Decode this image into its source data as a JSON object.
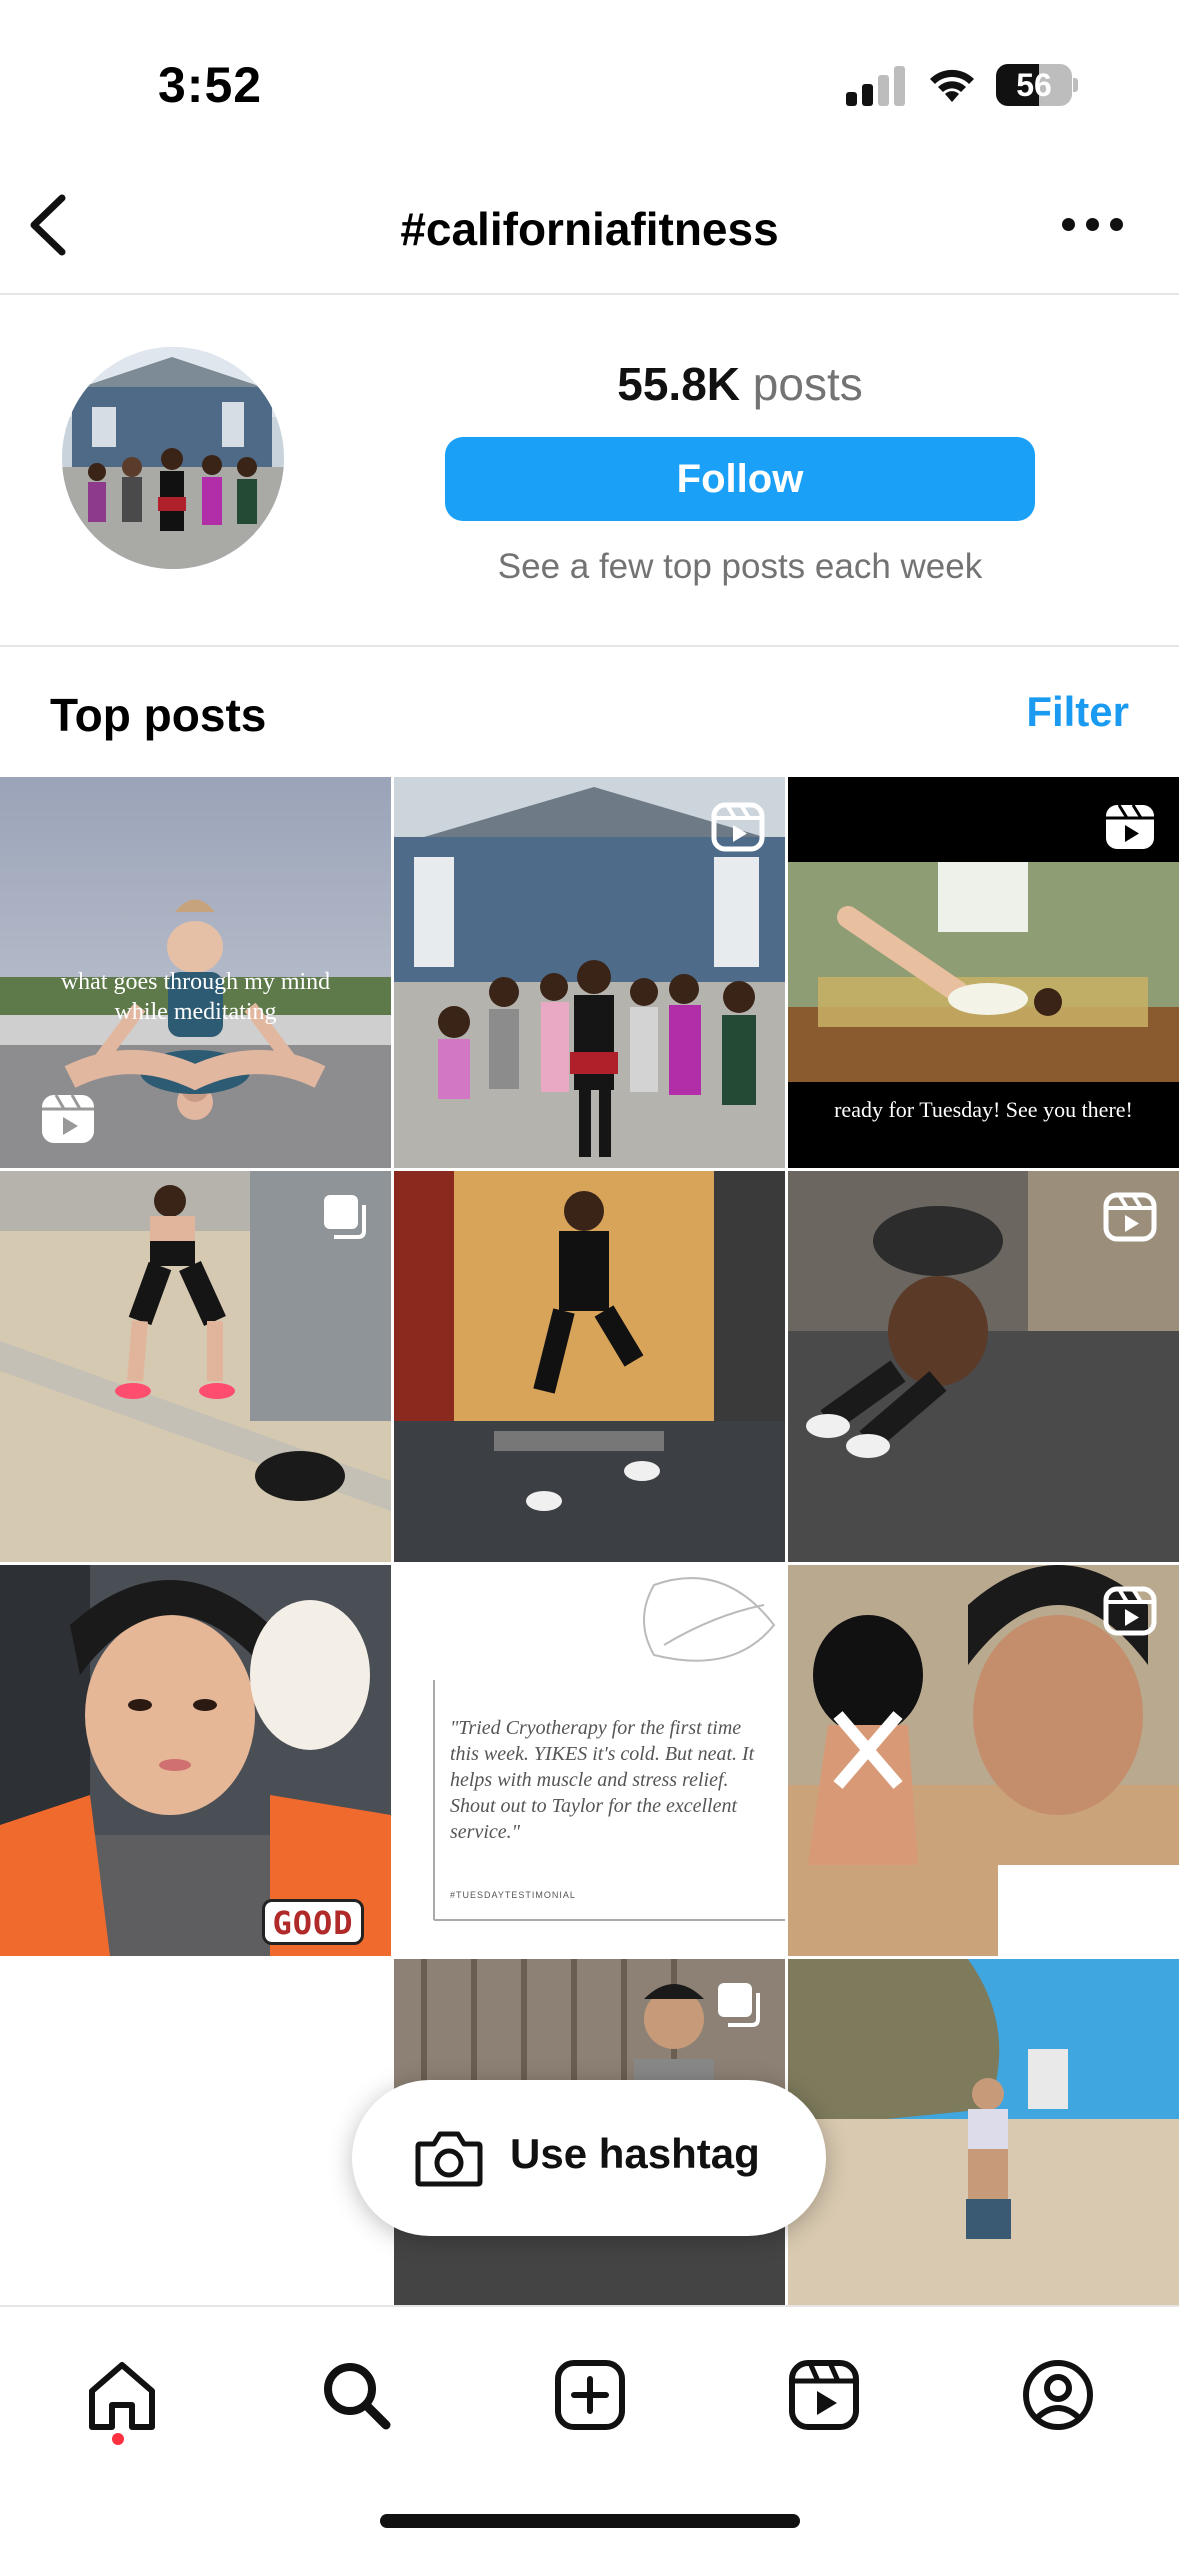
{
  "status_bar": {
    "time": "3:52",
    "battery_level": "56",
    "icons": [
      "cellular-signal-icon",
      "wifi-icon",
      "battery-icon"
    ]
  },
  "header": {
    "title": "#californiafitness",
    "icons": [
      "back-chevron-icon",
      "more-options-icon"
    ]
  },
  "profile": {
    "posts_count": "55.8K",
    "posts_label": "posts",
    "follow_label": "Follow",
    "follow_note": "See a few top posts each week"
  },
  "top_posts": {
    "title": "Top posts",
    "filter_label": "Filter",
    "tiles": [
      {
        "overlay_text": "what goes through my mind while meditating",
        "badge": "reels-icon"
      },
      {
        "overlay_text": "",
        "badge": "reels-icon"
      },
      {
        "overlay_text": "ready for Tuesday! See you there!",
        "badge": "reels-icon"
      },
      {
        "overlay_text": "",
        "badge": "carousel-icon"
      },
      {
        "overlay_text": "",
        "badge": ""
      },
      {
        "overlay_text": "",
        "badge": "reels-icon"
      },
      {
        "overlay_text": "GOOD",
        "badge": ""
      },
      {
        "overlay_text": "\"Tried Cryotherapy for the first time this week. YIKES it's cold. But neat. It helps with muscle and stress relief. Shout out to Taylor for the excellent service.\"",
        "caption_tag": "#TUESDAYTESTIMONIAL",
        "badge": ""
      },
      {
        "overlay_text": "",
        "badge": "reels-icon"
      },
      {
        "overlay_text": "",
        "badge": "carousel-icon"
      },
      {
        "overlay_text": "",
        "badge": ""
      }
    ]
  },
  "floating_button": {
    "label": "Use hashtag",
    "icon": "camera-icon"
  },
  "bottom_nav": {
    "items": [
      "home-icon",
      "search-icon",
      "create-post-icon",
      "reels-icon",
      "profile-icon"
    ],
    "active": "home-icon"
  },
  "colors": {
    "accent": "#1aa1f7",
    "filter": "#1a9af0",
    "notification_dot": "#ff3040",
    "secondary_text": "#737373"
  }
}
